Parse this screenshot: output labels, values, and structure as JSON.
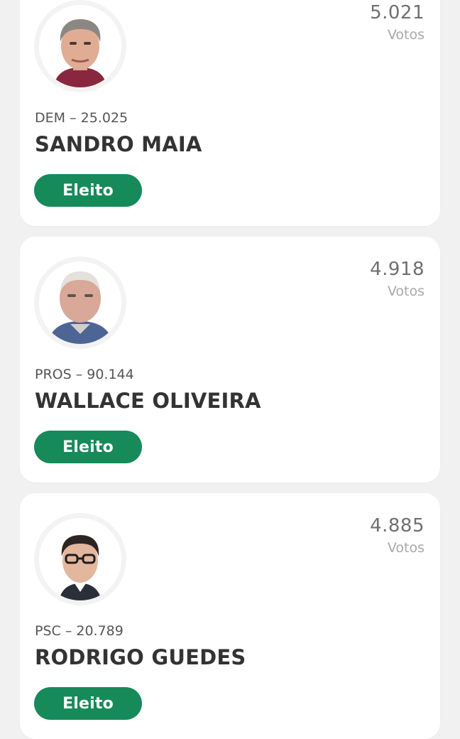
{
  "candidates": [
    {
      "votes": "5.021",
      "votes_label": "Votos",
      "party_number": "DEM – 25.025",
      "name": "SANDRO MAIA",
      "status": "Eleito",
      "photo_icon": "candidate-photo-sandro-maia"
    },
    {
      "votes": "4.918",
      "votes_label": "Votos",
      "party_number": "PROS – 90.144",
      "name": "WALLACE OLIVEIRA",
      "status": "Eleito",
      "photo_icon": "candidate-photo-wallace-oliveira"
    },
    {
      "votes": "4.885",
      "votes_label": "Votos",
      "party_number": "PSC – 20.789",
      "name": "RODRIGO GUEDES",
      "status": "Eleito",
      "photo_icon": "candidate-photo-rodrigo-guedes"
    }
  ],
  "colors": {
    "background": "#f1f1f1",
    "card": "#ffffff",
    "elected_badge": "#178a5a",
    "vote_count": "#6f6f6f",
    "vote_label": "#a8a8a8",
    "name": "#333333"
  }
}
